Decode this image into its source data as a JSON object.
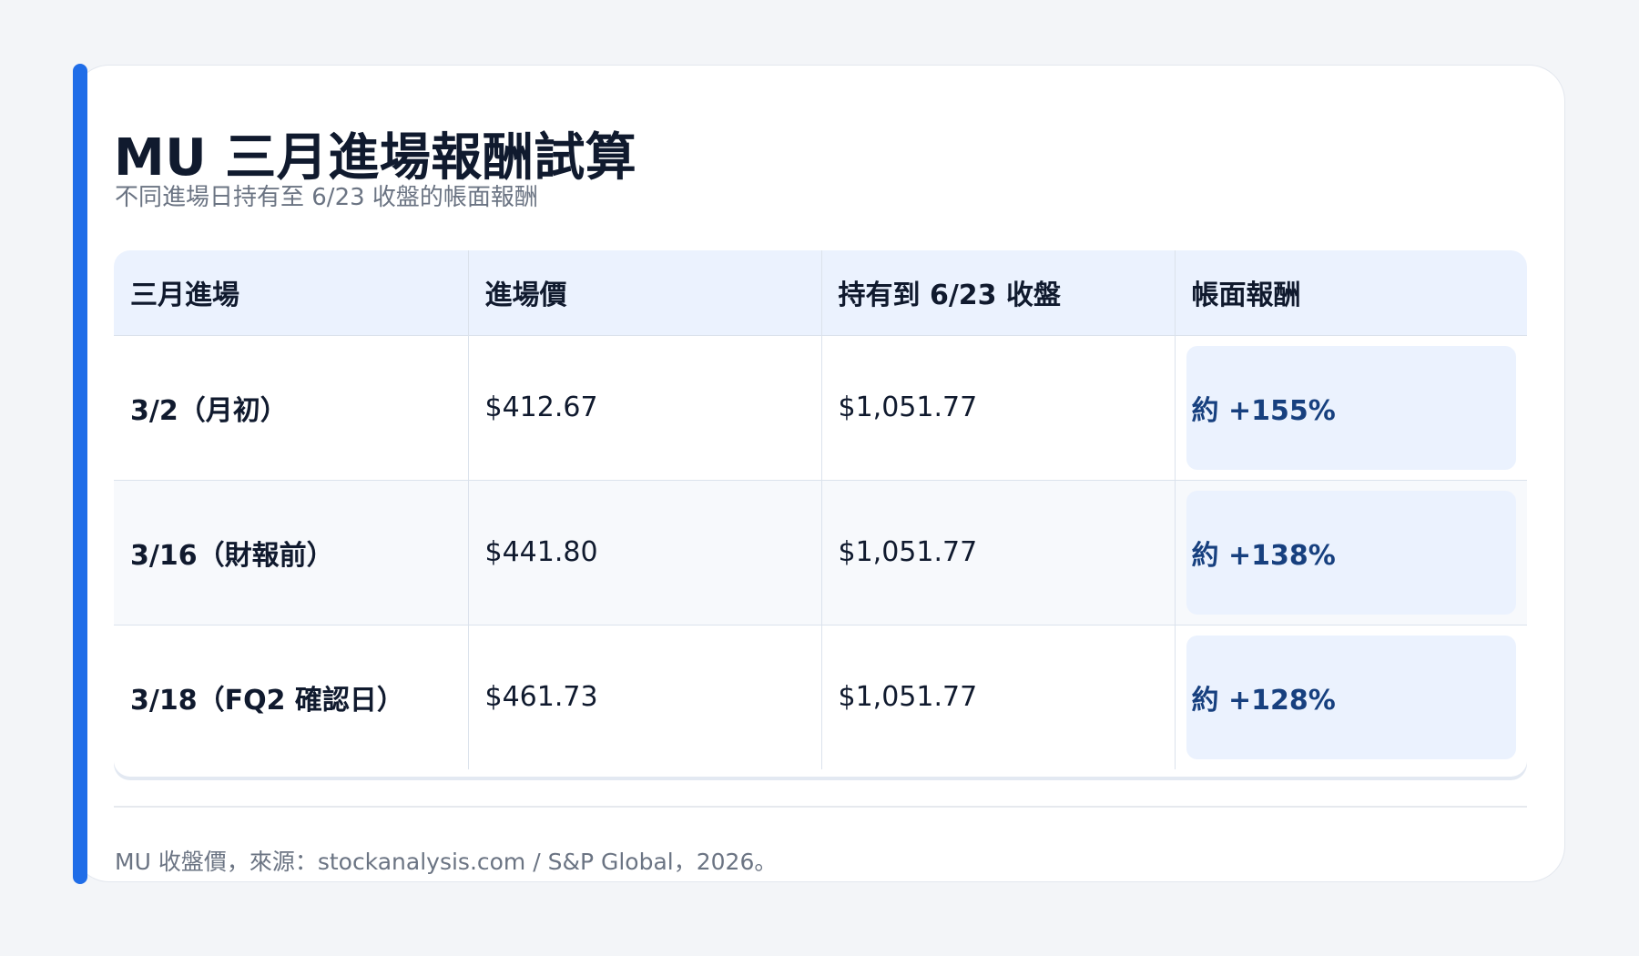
{
  "title": "MU 三月進場報酬試算",
  "subtitle": "不同進場日持有至 6/23 收盤的帳面報酬",
  "table": {
    "headers": [
      "三月進場",
      "進場價",
      "持有到 6/23 收盤",
      "帳面報酬"
    ],
    "rows": [
      {
        "entry": "3/2（月初）",
        "price": "$412.67",
        "close": "$1,051.77",
        "return": "約 +155%"
      },
      {
        "entry": "3/16（財報前）",
        "price": "$441.80",
        "close": "$1,051.77",
        "return": "約 +138%"
      },
      {
        "entry": "3/18（FQ2 確認日）",
        "price": "$461.73",
        "close": "$1,051.77",
        "return": "約 +128%"
      }
    ]
  },
  "footnote": "MU 收盤價，來源：stockanalysis.com / S&P Global，2026。",
  "colors": {
    "accent": "#1f6de8",
    "header_bg": "#ebf2fe",
    "return_text": "#17407f"
  }
}
